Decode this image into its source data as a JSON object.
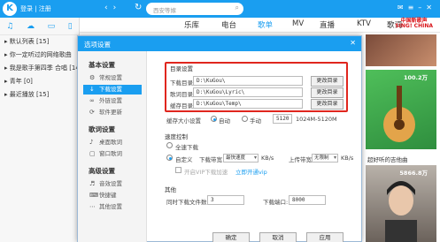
{
  "app": {
    "logo_glyph": "K",
    "login_label": "登录 | 注册",
    "search_placeholder": "西安等嫁"
  },
  "colors": {
    "accent": "#1a9ef0",
    "highlight_box": "#e0261e",
    "brand_red": "#d8141a"
  },
  "tabs": [
    "乐库",
    "电台",
    "歌单",
    "MV",
    "直播",
    "KTV",
    "歌词"
  ],
  "active_tab": "歌单",
  "brand": {
    "line1": "中国新歌声",
    "line2": "SING! CHINA"
  },
  "sidebar": {
    "items": [
      "默认列表 [15]",
      "你一定听过的网络歌曲",
      "我是歌手第四季 合唱 [14]",
      "青年 [0]",
      "最近播放 [15]"
    ]
  },
  "right_panel": [
    {
      "plays": "100.2万",
      "caption": "超好听的吉他曲"
    },
    {
      "plays": "5866.8万",
      "caption": ""
    }
  ],
  "dialog": {
    "title": "选项设置",
    "nav_groups": [
      {
        "title": "基本设置",
        "items": [
          "常规设置",
          "下载设置",
          "外链设置",
          "软件更新"
        ]
      },
      {
        "title": "歌词设置",
        "items": [
          "桌面歌词",
          "窗口歌词"
        ]
      },
      {
        "title": "高级设置",
        "items": [
          "音效设置",
          "快捷键",
          "其他设置"
        ]
      }
    ],
    "active_nav": "下载设置",
    "dir_section": {
      "title": "目录设置",
      "rows": [
        {
          "label": "下载目录",
          "value": "D:\\KuGou\\",
          "button": "更改目录"
        },
        {
          "label": "歌词目录",
          "value": "D:\\KuGou\\Lyric\\",
          "button": "更改目录"
        },
        {
          "label": "缓存目录",
          "value": "D:\\KuGou\\Temp\\",
          "button": "更改目录"
        }
      ]
    },
    "cache": {
      "label": "缓存大小设置",
      "auto": "自动",
      "manual": "手动",
      "value": "5120",
      "range": "1024M-5120M"
    },
    "speed": {
      "title": "速度控制",
      "full": "全速下载",
      "custom": "自定义",
      "dl_label": "下载带宽",
      "dl_value": "最快速度",
      "dl_unit": "KB/s",
      "ul_label": "上传带宽",
      "ul_value": "无限制",
      "ul_unit": "KB/s",
      "vip": "开启VIP下载加速",
      "vip_link": "立即开通vip"
    },
    "other": {
      "title": "其他",
      "tasks_label": "同时下载文件数:",
      "tasks_value": "3",
      "port_label": "下载端口:",
      "port_value": "8000"
    },
    "footer": [
      "确定",
      "取消",
      "应用"
    ]
  }
}
